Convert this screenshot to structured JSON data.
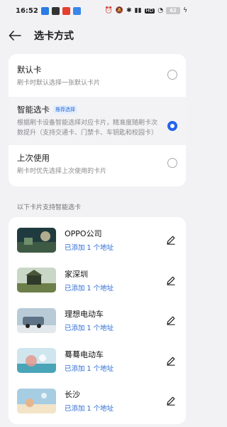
{
  "status_bar": {
    "time": "16:52",
    "battery": "62",
    "hd_label": "HD",
    "colors": {
      "app1": "#2b7be4",
      "app2": "#333333",
      "app3": "#e43f2f",
      "app4": "#3a86e9"
    }
  },
  "header": {
    "back_icon": "arrow-left-icon",
    "title": "选卡方式"
  },
  "options": [
    {
      "title": "默认卡",
      "badge": "",
      "desc": "刷卡时默认选择一张默认卡片",
      "selected": false
    },
    {
      "title": "智能选卡",
      "badge": "推荐选择",
      "desc": "根据刷卡设备智能选择对应卡片，精准度随刷卡次数提升（支持交通卡、门禁卡、车钥匙和校园卡）",
      "selected": true
    },
    {
      "title": "上次使用",
      "badge": "",
      "desc": "刷卡时优先选择上次使用的卡片",
      "selected": false
    }
  ],
  "section_label": "以下卡片支持智能选卡",
  "cards": [
    {
      "name": "OPPO公司",
      "sub": "已添加 1 个地址",
      "thumb_colors": [
        "#1f3b3f",
        "#6f8f6c",
        "#d9c9a2"
      ]
    },
    {
      "name": "家深圳",
      "sub": "已添加 1 个地址",
      "thumb_colors": [
        "#c9d7c7",
        "#6c7f4a",
        "#2f3a2a"
      ]
    },
    {
      "name": "理想电动车",
      "sub": "已添加 1 个地址",
      "thumb_colors": [
        "#b8cbd7",
        "#5e7386",
        "#e3e8ec"
      ]
    },
    {
      "name": "蓦蓦电动车",
      "sub": "已添加 1 个地址",
      "thumb_colors": [
        "#cfe6ef",
        "#4aa4b8",
        "#e39a8f"
      ]
    },
    {
      "name": "长沙",
      "sub": "已添加 1 个地址",
      "thumb_colors": [
        "#a7cde3",
        "#e6b58c",
        "#f3e4c8"
      ]
    }
  ],
  "accent_color": "#2463eb",
  "link_color": "#2a6bd8"
}
